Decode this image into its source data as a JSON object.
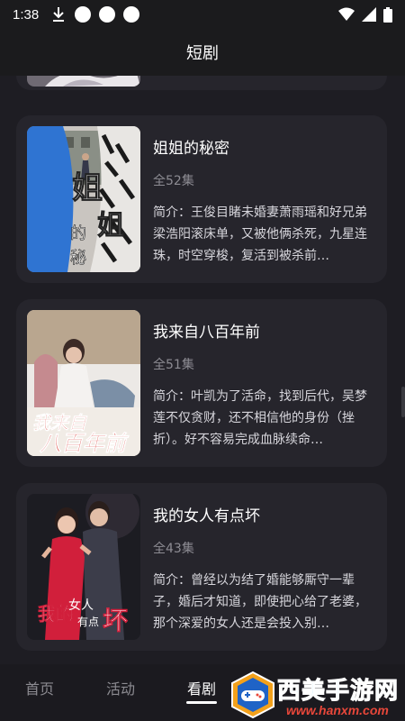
{
  "status_bar": {
    "time": "1:38"
  },
  "header": {
    "title": "短剧"
  },
  "dramas": [
    {
      "title": "姐姐的秘密",
      "episodes": "全52集",
      "description": "简介：王俊目睹未婚妻萧雨瑶和好兄弟梁浩阳滚床单，又被他俩杀死，九星连珠，时空穿梭，复活到被杀前…",
      "poster_text": "姐姐的秘密"
    },
    {
      "title": "我来自八百年前",
      "episodes": "全51集",
      "description": "简介：叶凯为了活命，找到后代，吴梦莲不仅贪财，还不相信他的身份（挫折）。好不容易完成血脉续命…",
      "poster_text": "我来自八百年前"
    },
    {
      "title": "我的女人有点坏",
      "episodes": "全43集",
      "description": "简介：曾经以为结了婚能够厮守一辈子，婚后才知道，即使把心给了老婆，那个深爱的女人还是会投入别…",
      "poster_text": "我的女人有点坏"
    }
  ],
  "bottom_nav": {
    "items": [
      {
        "label": "首页"
      },
      {
        "label": "活动"
      },
      {
        "label": "看剧"
      }
    ],
    "active_index": 2
  },
  "watermark": {
    "text": "西美手游网",
    "url": "www.hanxm.com"
  },
  "colors": {
    "background": "#1e1d23",
    "card": "#26252c",
    "bar": "#1b1b1d",
    "muted": "#8d8c93"
  }
}
